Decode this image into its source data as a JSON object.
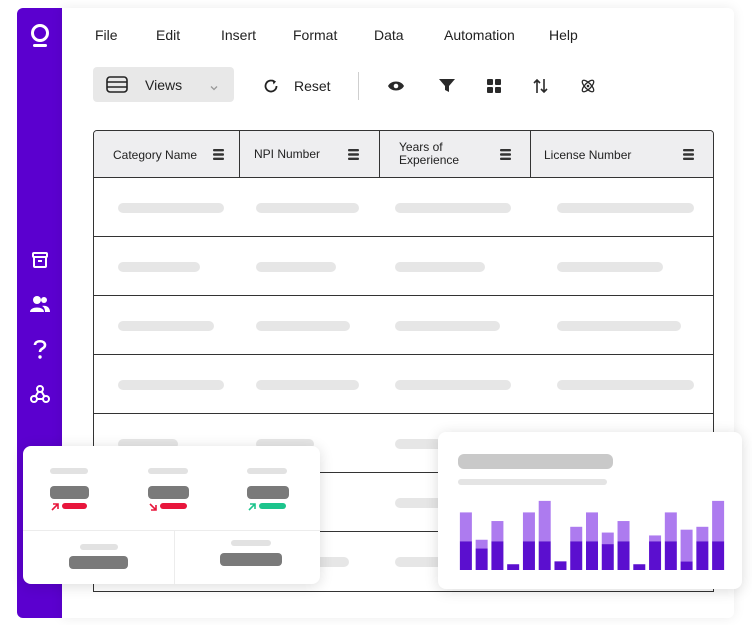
{
  "menu": {
    "file": "File",
    "edit": "Edit",
    "insert": "Insert",
    "format": "Format",
    "data": "Data",
    "automation": "Automation",
    "help": "Help"
  },
  "toolbar": {
    "views_label": "Views",
    "reset_label": "Reset"
  },
  "table": {
    "headers": [
      "Category Name",
      "NPI Number",
      "Years of Experience",
      "License Number"
    ],
    "header_line1": "Years of",
    "header_line2": "Experience"
  },
  "colors": {
    "brand": "#5b00cf",
    "bar_dark": "#5b0fcf",
    "bar_light": "#ad7bef",
    "trend_down": "#e8163c",
    "trend_up": "#1cc48c"
  },
  "icons": {
    "logo": "logo-icon",
    "archive": "archive-icon",
    "users": "users-icon",
    "help": "help-icon",
    "webhook": "webhook-icon",
    "eye": "eye-icon",
    "filter": "filter-icon",
    "group": "grid-icon",
    "sort": "sort-icon",
    "atom": "atom-icon"
  },
  "chart_data": {
    "type": "bar",
    "title": "",
    "xlabel": "",
    "ylabel": "",
    "series": [
      {
        "values": [
          2,
          1.5,
          2,
          0.4,
          2,
          2,
          0.6,
          2,
          2,
          1.8,
          2,
          0.4,
          2,
          2,
          0.6,
          2,
          2
        ]
      },
      {
        "values": [
          2,
          0.6,
          1.4,
          0,
          2,
          2.8,
          0,
          1,
          2,
          0.8,
          1.4,
          0,
          0.4,
          2,
          2.2,
          1.0,
          2.8
        ]
      }
    ],
    "ylim": [
      0,
      5
    ]
  }
}
